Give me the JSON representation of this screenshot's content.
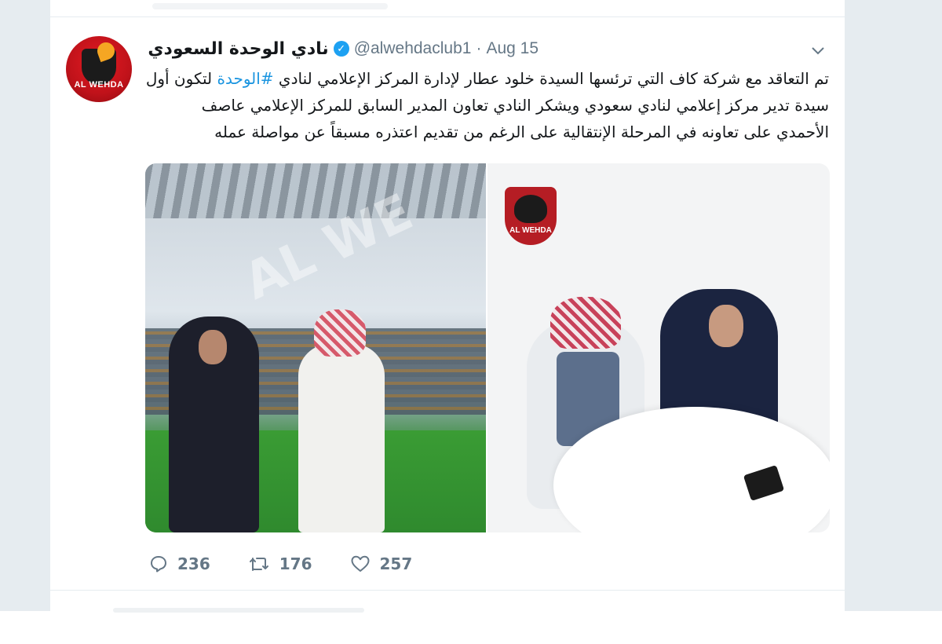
{
  "tweet": {
    "display_name": "نادي الوحدة السعودي",
    "handle": "@alwehdaclub1",
    "separator": "·",
    "date": "Aug 15",
    "text_before_hashtag": "تم التعاقد مع شركة كاف التي ترئسها السيدة خلود عطار لإدارة المركز الإعلامي لنادي ",
    "hashtag": "#الوحدة",
    "text_after_hashtag": " لتكون أول سيدة تدير مركز إعلامي لنادي سعودي  ويشكر النادي  تعاون المدير السابق للمركز الإعلامي عاصف الأحمدي  على تعاونه في المرحلة الإنتقالية على الرغم من تقديم اعتذره مسبقاً عن مواصلة عمله",
    "avatar_text": "AL WEHDA",
    "media": {
      "left_watermark": "AL WE",
      "right_logo_text": "AL WEHDA"
    },
    "actions": {
      "reply_count": "236",
      "retweet_count": "176",
      "like_count": "257"
    }
  },
  "icons": {
    "verified": "verified-badge-icon",
    "caret": "chevron-down-icon",
    "reply": "reply-icon",
    "retweet": "retweet-icon",
    "like": "heart-icon"
  },
  "colors": {
    "link": "#1b95e0",
    "verified": "#1da1f2",
    "muted": "#657786",
    "text": "#14171a",
    "page_background": "#e6ecf0"
  }
}
